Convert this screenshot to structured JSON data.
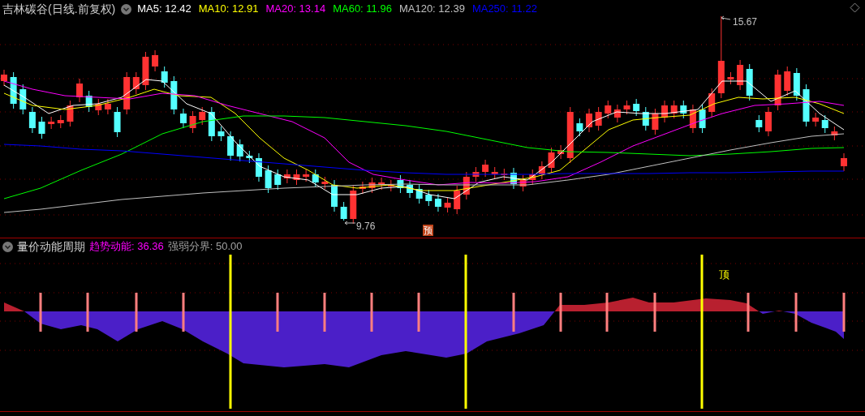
{
  "price_panel": {
    "title": "吉林碳谷(日线.前复权)",
    "indicators": [
      {
        "label": "MA5: 12.42",
        "color": "#ffffff"
      },
      {
        "label": "MA10: 12.91",
        "color": "#ffff00"
      },
      {
        "label": "MA20: 13.14",
        "color": "#ff00ff"
      },
      {
        "label": "MA60: 11.96",
        "color": "#00ff00"
      },
      {
        "label": "MA120: 12.39",
        "color": "#c0c0c0"
      },
      {
        "label": "MA250: 11.22",
        "color": "#0000ff"
      }
    ],
    "high_label": "15.67",
    "low_label": "9.76",
    "forecast_badge": "预"
  },
  "indicator_panel": {
    "title": "量价动能周期",
    "indicators": [
      {
        "label": "趋势动能: 36.36",
        "color": "#ff00ff"
      },
      {
        "label": "强弱分界: 50.00",
        "color": "#a0a0a0"
      }
    ],
    "top_marker": "顶"
  }
}
